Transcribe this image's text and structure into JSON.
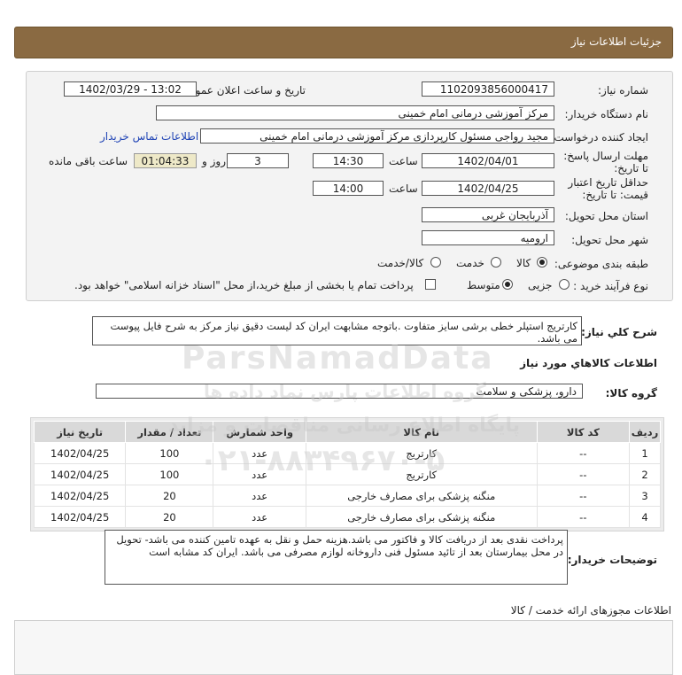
{
  "header": {
    "title": "جزئیات اطلاعات نیاز"
  },
  "form": {
    "need_number_label": "شماره نیاز:",
    "need_number": "1102093856000417",
    "announce_label": "تاریخ و ساعت اعلان عمومی:",
    "announce_value": "1402/03/29 - 13:02",
    "buyer_org_label": "نام دستگاه خریدار:",
    "buyer_org": "مرکز آموزشی درمانی امام خمینی",
    "requester_label": "ایجاد کننده درخواست:",
    "requester": "مجید  رواجی مسئول کارپردازی مرکز آموزشی درمانی امام خمینی",
    "contact_link": "اطلاعات تماس خریدار",
    "deadline_label": "مهلت ارسال پاسخ: تا تاریخ:",
    "deadline_date": "1402/04/01",
    "time_label": "ساعت",
    "deadline_time": "14:30",
    "days_value": "3",
    "days_label": "روز و",
    "remaining_time": "01:04:33",
    "remaining_label": "ساعت باقی مانده",
    "validity_label": "حداقل تاریخ اعتبار قیمت: تا تاریخ:",
    "validity_date": "1402/04/25",
    "validity_time": "14:00",
    "province_label": "استان محل تحویل:",
    "province": "آذربایجان غربی",
    "city_label": "شهر محل تحویل:",
    "city": "ارومیه",
    "category_label": "طبقه بندی موضوعی:",
    "category_options": [
      "کالا",
      "خدمت",
      "کالا/خدمت"
    ],
    "category_selected": "کالا",
    "process_label": "نوع فرآیند خرید :",
    "process_options": [
      "جزیی",
      "متوسط"
    ],
    "process_selected": "متوسط",
    "payment_note": "پرداخت تمام یا بخشی از مبلغ خرید،از محل \"اسناد خزانه اسلامی\" خواهد بود."
  },
  "description": {
    "label": "شرح کلي نياز:",
    "text": "کارتریج استپلر خطی برشی سایز متفاوت .باتوجه مشابهت ایران کد لیست دقیق نیاز مرکز به شرح فایل پیوست می باشد."
  },
  "goods": {
    "section_title": "اطلاعات کالاهاي مورد نياز",
    "group_label": "گروه کالا:",
    "group_value": "دارو، پزشکی و سلامت",
    "columns": [
      "ردیف",
      "کد کالا",
      "نام کالا",
      "واحد شمارش",
      "تعداد / مقدار",
      "تاریخ نیاز"
    ],
    "rows": [
      [
        "1",
        "--",
        "کارتریج",
        "عدد",
        "100",
        "1402/04/25"
      ],
      [
        "2",
        "--",
        "کارتریج",
        "عدد",
        "100",
        "1402/04/25"
      ],
      [
        "3",
        "--",
        "منگنه پزشکی برای مصارف خارجی",
        "عدد",
        "20",
        "1402/04/25"
      ],
      [
        "4",
        "--",
        "منگنه پزشکی برای مصارف خارجی",
        "عدد",
        "20",
        "1402/04/25"
      ]
    ]
  },
  "buyer_notes": {
    "label": "توضیحات خریدار:",
    "text": "پرداخت نقدی بعد از دریافت کالا و فاکتور می باشد.هزینه حمل و نقل به عهده تامین کننده می باشد- تحویل در محل بیمارستان بعد از تائید مسئول فنی داروخانه لوازم مصرفی می باشد. ایران کد مشابه است"
  },
  "service_permits": {
    "label": "اطلاعات مجوزهای ارائه خدمت / کالا"
  },
  "watermark": {
    "brand": "ParsNamadData",
    "line1": "پایگاه اطلاع رسانی مناقصات و مزاید",
    "line2": "گروه اطلاعات پارس نماد داده ها",
    "phone": "۰۲۱-۸۸۳۴۹۶۷۰-۵"
  },
  "colors": {
    "header_bg": "#8a6a42",
    "panel_bg": "#f3f3f3",
    "link": "#1f43b5",
    "remaining_bg": "#eee9c8"
  }
}
